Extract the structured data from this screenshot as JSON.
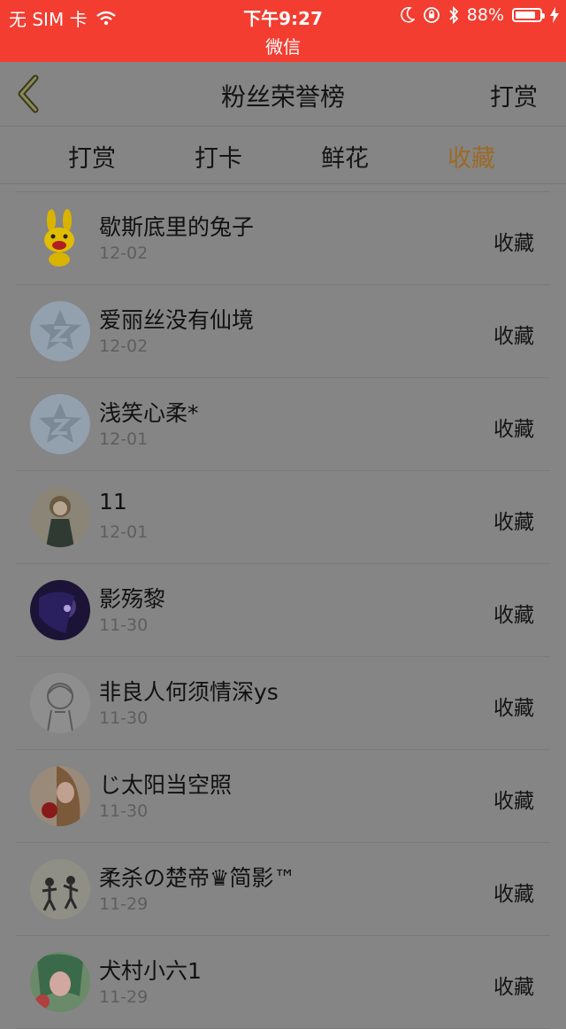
{
  "status_bar": {
    "carrier": "无 SIM 卡",
    "time": "下午9:27",
    "app": "微信",
    "battery": "88%",
    "battery_level": 0.88
  },
  "nav": {
    "title": "粉丝荣誉榜",
    "action": "打赏"
  },
  "tabs": [
    {
      "label": "打赏",
      "active": false
    },
    {
      "label": "打卡",
      "active": false
    },
    {
      "label": "鲜花",
      "active": false
    },
    {
      "label": "收藏",
      "active": true
    }
  ],
  "colors": {
    "status_bar": "#f23d30",
    "active_tab": "#9c6a26"
  },
  "rows": [
    {
      "name": "歇斯底里的兔子",
      "date": "12-02",
      "action": "收藏",
      "avatar": "bunny-icon"
    },
    {
      "name": "爱丽丝没有仙境",
      "date": "12-02",
      "action": "收藏",
      "avatar": "default-qzone-avatar"
    },
    {
      "name": "浅笑心柔*",
      "date": "12-01",
      "action": "收藏",
      "avatar": "default-qzone-avatar"
    },
    {
      "name": "11",
      "date": "12-01",
      "action": "收藏",
      "avatar": "photo-avatar"
    },
    {
      "name": "影殇黎",
      "date": "11-30",
      "action": "收藏",
      "avatar": "photo-avatar"
    },
    {
      "name": "非良人何须情深ys",
      "date": "11-30",
      "action": "收藏",
      "avatar": "sketch-avatar"
    },
    {
      "name": "じ太阳当空照",
      "date": "11-30",
      "action": "收藏",
      "avatar": "photo-avatar"
    },
    {
      "name": "柔杀の楚帝♛简影™",
      "date": "11-29",
      "action": "收藏",
      "avatar": "photo-avatar"
    },
    {
      "name": "犬村小六1",
      "date": "11-29",
      "action": "收藏",
      "avatar": "photo-avatar"
    }
  ]
}
